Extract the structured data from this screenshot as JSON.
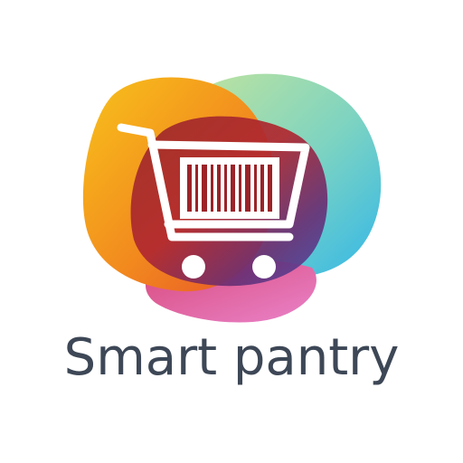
{
  "logo": {
    "brand_name": "Smart pantry",
    "icon": "shopping-cart-barcode-icon",
    "colors": {
      "text": "#3d4756",
      "orange": "#f28a1e",
      "yellow": "#f7b71b",
      "green": "#9ed79a",
      "blue": "#33b7e8",
      "purple": "#4b4aa8",
      "pink": "#e36fb8",
      "dark_red": "#8b1f2a",
      "red": "#d92a37"
    }
  }
}
